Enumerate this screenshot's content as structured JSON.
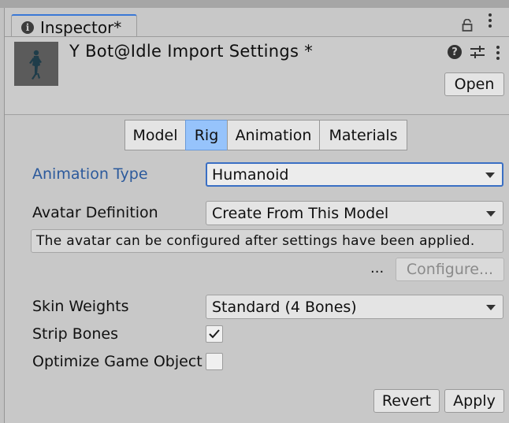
{
  "window": {
    "tab_label": "Inspector*",
    "tab_icon": "info-icon",
    "lock_icon": "lock-icon",
    "menu_icon": "kebab-menu-icon"
  },
  "header": {
    "title": "Y Bot@Idle Import Settings *",
    "open_label": "Open",
    "help_icon": "help-icon",
    "help_glyph": "?",
    "presets_icon": "sliders-icon",
    "menu_icon": "kebab-menu-icon"
  },
  "tabs": [
    {
      "label": "Model",
      "active": false
    },
    {
      "label": "Rig",
      "active": true
    },
    {
      "label": "Animation",
      "active": false
    },
    {
      "label": "Materials",
      "active": false
    }
  ],
  "fields": {
    "animation_type": {
      "label": "Animation Type",
      "value": "Humanoid"
    },
    "avatar_definition": {
      "label": "Avatar Definition",
      "value": "Create From This Model"
    },
    "help_text": "The avatar can be configured after settings have been applied.",
    "ellipsis": "...",
    "configure_label": "Configure...",
    "skin_weights": {
      "label": "Skin Weights",
      "value": "Standard (4 Bones)"
    },
    "strip_bones": {
      "label": "Strip Bones",
      "checked": true
    },
    "optimize_game_objects": {
      "label": "Optimize Game Object",
      "checked": false
    }
  },
  "footer": {
    "revert_label": "Revert",
    "apply_label": "Apply"
  },
  "colors": {
    "accent_tab": "#3a78d6",
    "active_toolbar": "#96c3fb",
    "focused_label": "#2c5a9c"
  }
}
